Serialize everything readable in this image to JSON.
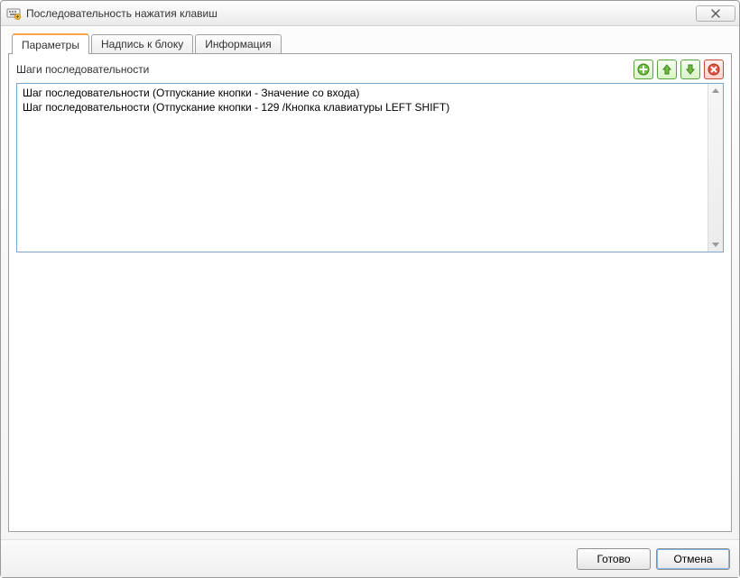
{
  "window": {
    "title": "Последовательность нажатия клавиш"
  },
  "tabs": [
    {
      "label": "Параметры"
    },
    {
      "label": "Надпись к блоку"
    },
    {
      "label": "Информация"
    }
  ],
  "list": {
    "label": "Шаги последовательности",
    "items": [
      "Шаг последовательности (Отпускание кнопки - Значение со входа)",
      "Шаг последовательности (Отпускание кнопки - 129 /Кнопка клавиатуры LEFT SHIFT)"
    ]
  },
  "icons": {
    "add": "add-icon",
    "up": "arrow-up-icon",
    "down": "arrow-down-icon",
    "delete": "delete-icon"
  },
  "footer": {
    "ok": "Готово",
    "cancel": "Отмена"
  }
}
